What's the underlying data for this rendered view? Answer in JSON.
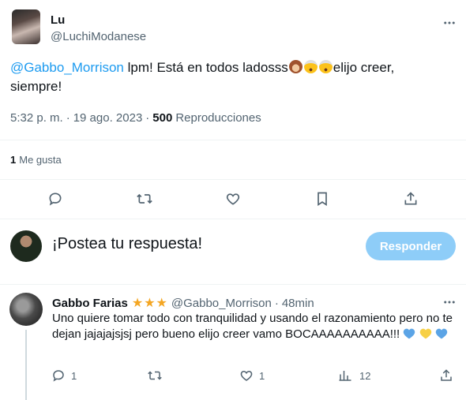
{
  "tweet": {
    "author_name": "Lu",
    "author_handle": "@LuchiModanese",
    "text_mention": "@Gabbo_Morrison",
    "text_body_1": " lpm! Está en todos ladosss",
    "text_body_2": "elijo creer,",
    "text_body_3": "siempre!",
    "time": "5:32 p. m.",
    "separator": "·",
    "date": "19 ago. 2023",
    "views_count": "500",
    "views_label": "Reproducciones",
    "likes_count": "1",
    "likes_label": "Me gusta",
    "more_label": "···"
  },
  "compose": {
    "placeholder": "¡Postea tu respuesta!",
    "button_label": "Responder"
  },
  "reply": {
    "author_name": "Gabbo Farias",
    "stars": "★★★",
    "author_handle": "@Gabbo_Morrison",
    "separator": "·",
    "time": "48min",
    "text": "Uno quiere tomar todo con tranquilidad y usando el razonamiento pero no te dejan jajajajsjsj pero bueno elijo creer vamo BOCAAAAAAAAAA!!!",
    "reply_count": "1",
    "like_count": "1",
    "view_count": "12",
    "more_label": "···"
  },
  "colors": {
    "accent": "#1d9bf0",
    "muted": "#536471",
    "button_disabled": "#8ecdf8",
    "star": "#f4a623",
    "heart_blue": "#5ba4e6",
    "heart_yellow": "#f7d046"
  },
  "icons": {
    "reply": "comment-icon",
    "retweet": "retweet-icon",
    "like": "heart-icon",
    "bookmark": "bookmark-icon",
    "share": "share-icon",
    "views": "analytics-icon",
    "more": "more-icon"
  }
}
